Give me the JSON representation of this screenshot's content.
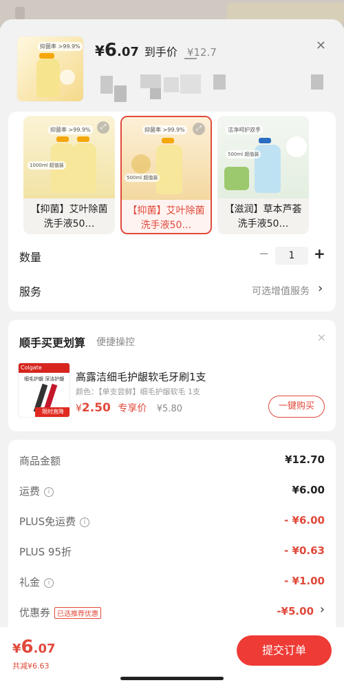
{
  "header": {
    "currency": "¥",
    "price_int": "6",
    "price_dec": ".07",
    "price_label": "到手价",
    "original_price": "¥12.7",
    "thumb_badge": "抑菌率 >99.9%"
  },
  "variants": [
    {
      "badge": "抑菌率 >99.9%",
      "volume": "1000ml 超值装",
      "label": "【抑菌】艾叶除菌洗手液50…",
      "selected": false
    },
    {
      "badge": "抑菌率 >99.9%",
      "volume": "500ml 超值装",
      "label": "【抑菌】艾叶除菌洗手液50…",
      "selected": true
    },
    {
      "badge": "洁净呵护双手",
      "volume": "500ml 超值装",
      "label": "【滋润】草本芦荟洗手液50…",
      "selected": false
    }
  ],
  "quantity": {
    "label": "数量",
    "minus": "−",
    "value": "1",
    "plus": "+"
  },
  "service": {
    "label": "服务",
    "value": "可选增值服务",
    "chevron": "›"
  },
  "bundle": {
    "title": "顺手买更划算",
    "subtitle": "便捷操控",
    "close": "×",
    "product_name": "高露洁细毛护龈软毛牙刷1支",
    "spec": "颜色：【单支尝鲜】细毛护龈软毛 1支",
    "currency": "¥",
    "price": "2.50",
    "price_tag": "专享价",
    "orig_price": "¥5.80",
    "buy_label": "一键购买",
    "img_brand": "Colgate",
    "img_line": "细毛护龈 深洁护龈",
    "img_badge": "限时直降"
  },
  "summary": [
    {
      "label": "商品金额",
      "value": "¥12.70",
      "red": false,
      "info": false
    },
    {
      "label": "运费",
      "value": "¥6.00",
      "red": false,
      "info": true
    },
    {
      "label": "PLUS免运费",
      "value": "- ¥6.00",
      "red": true,
      "info": true
    },
    {
      "label": "PLUS 95折",
      "value": "- ¥0.63",
      "red": true,
      "info": false
    },
    {
      "label": "礼金",
      "value": "- ¥1.00",
      "red": true,
      "info": true
    },
    {
      "label": "优惠券",
      "value": "-¥5.00",
      "red": true,
      "info": false,
      "tag": "已选推荐优惠",
      "chevron": "›"
    }
  ],
  "bottom": {
    "currency": "¥",
    "price_int": "6",
    "price_dec": ".07",
    "saved": "共减¥6.63",
    "submit": "提交订单"
  },
  "colors": {
    "accent": "#ee3b36",
    "accent_text": "#e0493a"
  }
}
